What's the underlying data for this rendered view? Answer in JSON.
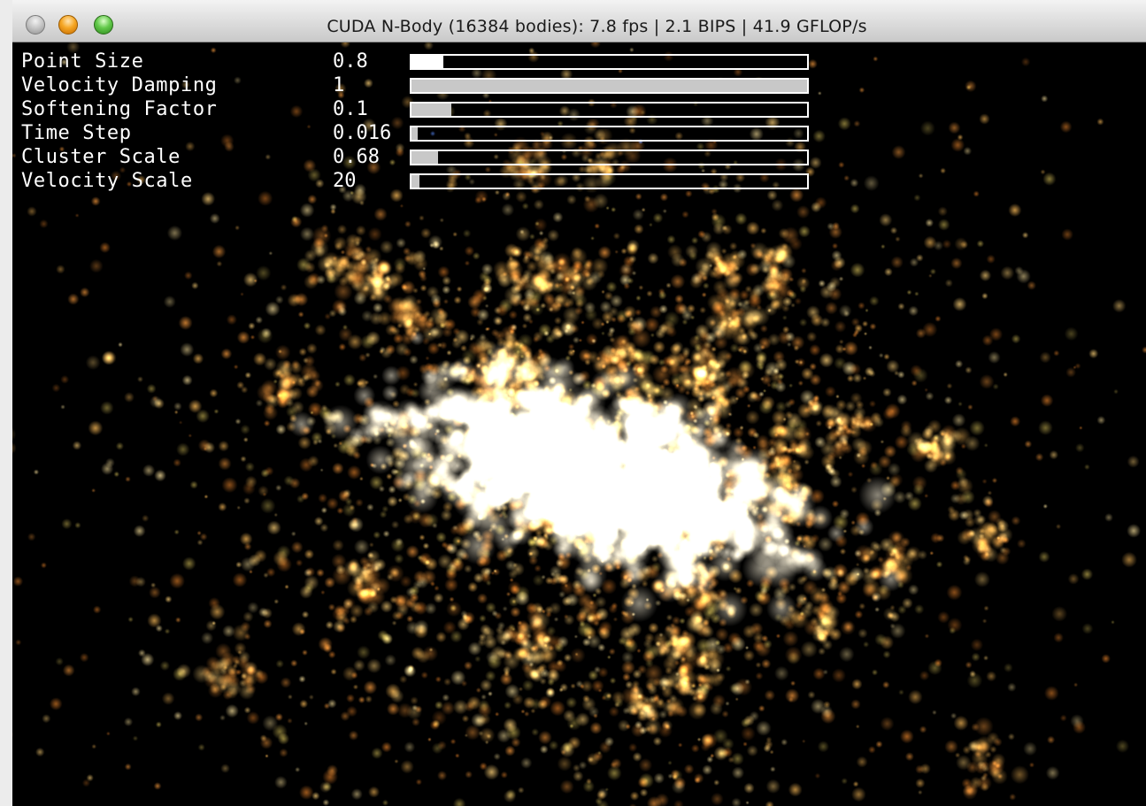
{
  "window": {
    "title": "CUDA N-Body (16384 bodies): 7.8 fps | 2.1 BIPS | 41.9 GFLOP/s",
    "buttons": [
      "close",
      "minimize",
      "zoom"
    ]
  },
  "parameters": [
    {
      "label": "Point Size",
      "value": "0.8",
      "fill": 0.08
    },
    {
      "label": "Velocity Damping",
      "value": "1",
      "fill": 1.0
    },
    {
      "label": "Softening Factor",
      "value": "0.1",
      "fill": 0.1
    },
    {
      "label": "Time Step",
      "value": "0.016",
      "fill": 0.016
    },
    {
      "label": "Cluster Scale",
      "value": "0.68",
      "fill": 0.068
    },
    {
      "label": "Velocity Scale",
      "value": "20",
      "fill": 0.02
    }
  ],
  "colors": {
    "background": "#000000",
    "particle_core": "#ffffff",
    "particle_glow": "#ffc760",
    "particle_dim": "#c07020",
    "slider_border": "#ffffff",
    "slider_fill": "#c8c8c8"
  }
}
